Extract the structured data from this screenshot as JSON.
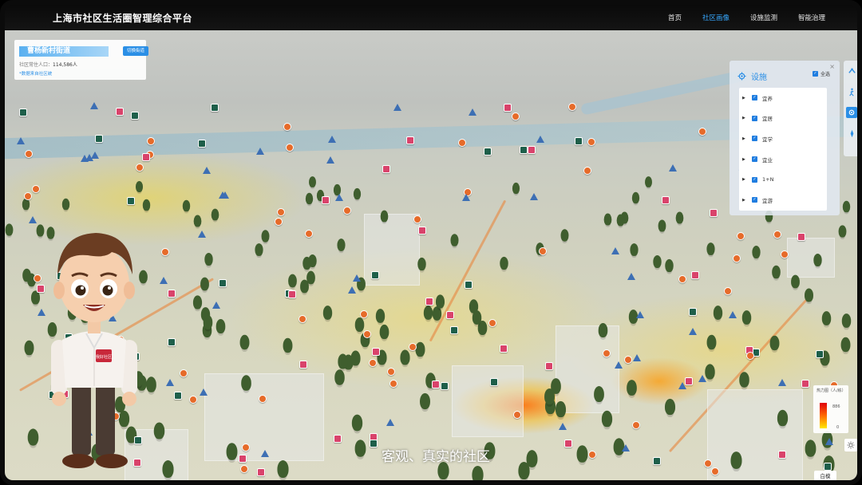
{
  "app": {
    "title": "上海市社区生活圈智理综合平台"
  },
  "nav": {
    "items": [
      {
        "label": "首页",
        "active": false
      },
      {
        "label": "社区画像",
        "active": true
      },
      {
        "label": "设施监测",
        "active": false
      },
      {
        "label": "智能治理",
        "active": false
      }
    ]
  },
  "info_panel": {
    "street_name": "曹杨新村街道",
    "switch_label": "切换街道",
    "population_label": "社区常住人口：",
    "population_value": "114,586人",
    "source_link": "*数据来自社区统"
  },
  "facilities": {
    "title": "设施",
    "check_all_label": "全选",
    "items": [
      {
        "label": "宜养",
        "checked": true
      },
      {
        "label": "宜居",
        "checked": true
      },
      {
        "label": "宜学",
        "checked": true
      },
      {
        "label": "宜业",
        "checked": true
      },
      {
        "label": "1+N",
        "checked": true
      },
      {
        "label": "宜游",
        "checked": true
      }
    ]
  },
  "legend": {
    "title": "热力图（人/栋）",
    "max": "886",
    "min": "0",
    "colors": [
      "#e0000a",
      "#ff6a00",
      "#ffe800"
    ]
  },
  "mode_button": "白模",
  "subtitle": "客观、真实的社区",
  "avatar": {
    "badge_text": "我好社区"
  },
  "colors": {
    "accent": "#2b8fe6",
    "nav_active": "#37a8ff",
    "topbar": "#0a0a0a"
  },
  "icons": {
    "toolbar": [
      "share-icon",
      "walker-icon",
      "settings-icon",
      "compass-icon"
    ],
    "panel": "gear-icon",
    "light": "sun-icon"
  }
}
